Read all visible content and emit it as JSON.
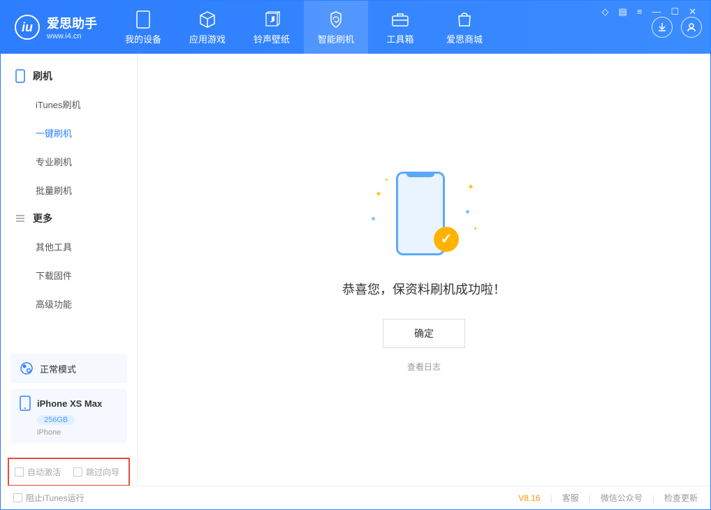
{
  "app": {
    "name": "爱思助手",
    "url": "www.i4.cn"
  },
  "nav": [
    {
      "label": "我的设备",
      "icon": "device"
    },
    {
      "label": "应用游戏",
      "icon": "cube"
    },
    {
      "label": "铃声壁纸",
      "icon": "music"
    },
    {
      "label": "智能刷机",
      "icon": "refresh",
      "active": true
    },
    {
      "label": "工具箱",
      "icon": "toolbox"
    },
    {
      "label": "爱思商城",
      "icon": "shop"
    }
  ],
  "sidebar": {
    "section1": {
      "title": "刷机",
      "items": [
        "iTunes刷机",
        "一键刷机",
        "专业刷机",
        "批量刷机"
      ],
      "activeIndex": 1
    },
    "section2": {
      "title": "更多",
      "items": [
        "其他工具",
        "下载固件",
        "高级功能"
      ]
    }
  },
  "status": {
    "mode": "正常模式"
  },
  "device": {
    "name": "iPhone XS Max",
    "capacity": "256GB",
    "type": "iPhone"
  },
  "checkboxes": {
    "auto_activate": "自动激活",
    "skip_guide": "跳过向导"
  },
  "main": {
    "success_message": "恭喜您，保资料刷机成功啦！",
    "confirm_label": "确定",
    "log_link": "查看日志"
  },
  "footer": {
    "block_itunes": "阻止iTunes运行",
    "version": "V8.16",
    "links": [
      "客服",
      "微信公众号",
      "检查更新"
    ]
  }
}
